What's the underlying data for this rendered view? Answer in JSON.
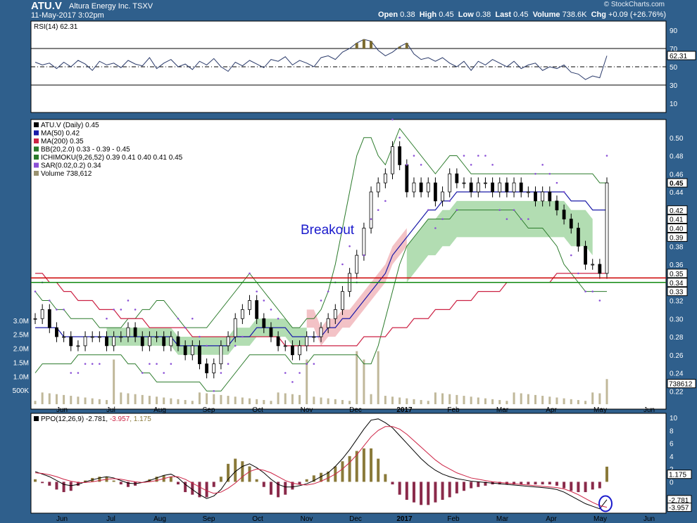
{
  "header": {
    "symbol": "ATU.V",
    "company": "Altura Energy Inc.",
    "exchange": "TSXV",
    "datetime": "11-May-2017 3:02pm",
    "brand": "© StockCharts.com",
    "quote": {
      "open_label": "Open",
      "open": "0.38",
      "high_label": "High",
      "high": "0.45",
      "low_label": "Low",
      "low": "0.38",
      "last_label": "Last",
      "last": "0.45",
      "volume_label": "Volume",
      "volume": "738.6K",
      "chg_label": "Chg",
      "chg": "+0.09 (+26.76%)"
    }
  },
  "colors": {
    "frame": "#2f5f8c",
    "panel": "#ffffff",
    "price": "#000000",
    "ma50": "#1a1aa8",
    "ma200": "#cc2244",
    "bb": "#2a7a2a",
    "kumo_bull": "#9fd49f",
    "kumo_bear": "#f0b3b8",
    "sar": "#8a4fd6",
    "volume": "#c0b89a",
    "resistance": "#cc0000",
    "support": "#118811",
    "annotation": "#1a1acc"
  },
  "chart_data": [
    {
      "type": "line",
      "panel": "rsi",
      "label": "RSI(14) 62.31",
      "yticks": [
        10,
        30,
        50,
        70,
        90
      ],
      "ylim": [
        0,
        100
      ],
      "thresholds": [
        30,
        70
      ],
      "last": 62.31,
      "last_label": "62.31",
      "series": [
        {
          "name": "RSI(14)",
          "values": [
            55,
            52,
            54,
            48,
            55,
            50,
            57,
            53,
            46,
            56,
            52,
            54,
            49,
            57,
            53,
            51,
            60,
            48,
            54,
            58,
            50,
            53,
            47,
            56,
            52,
            59,
            50,
            45,
            55,
            51,
            57,
            53,
            49,
            58,
            56,
            61,
            52,
            57,
            54,
            50,
            60,
            62,
            58,
            66,
            70,
            76,
            80,
            78,
            68,
            62,
            66,
            72,
            76,
            64,
            58,
            60,
            56,
            60,
            54,
            50,
            56,
            46,
            56,
            52,
            58,
            54,
            50,
            56,
            48,
            52,
            54,
            46,
            50,
            48,
            52,
            44,
            42,
            36,
            40,
            38,
            62
          ]
        }
      ]
    },
    {
      "type": "line",
      "panel": "price",
      "title": "ATU.V (Daily) 0.45",
      "ylim": [
        0.2,
        0.52
      ],
      "yticks": [
        0.22,
        0.24,
        0.26,
        0.28,
        0.3,
        0.32,
        0.34,
        0.36,
        0.38,
        0.4,
        0.42,
        0.44,
        0.46,
        0.48,
        0.5
      ],
      "ytick_labels": [
        "0.22",
        "0.24",
        "0.26",
        "0.28",
        "0.30",
        "0.32",
        "0.34",
        "0.36",
        "0.38",
        "0.40",
        "0.42",
        "0.44",
        "0.46",
        "0.48",
        "0.50"
      ],
      "volume_ticks": [
        {
          "label": "3.0M",
          "value": 3000000
        },
        {
          "label": "2.5M",
          "value": 2500000
        },
        {
          "label": "2.0M",
          "value": 2000000
        },
        {
          "label": "1.5M",
          "value": 1500000
        },
        {
          "label": "1.0M",
          "value": 1000000
        },
        {
          "label": "500K",
          "value": 500000
        }
      ],
      "x_labels": [
        "Jun",
        "Jul",
        "Aug",
        "Sep",
        "Oct",
        "Nov",
        "Dec",
        "2017",
        "Feb",
        "Mar",
        "Apr",
        "May",
        "Jun"
      ],
      "legend": [
        {
          "text": "ATU.V (Daily) 0.45",
          "color": "#000000"
        },
        {
          "text": "MA(50) 0.42",
          "color": "#1a1aa8"
        },
        {
          "text": "MA(200) 0.35",
          "color": "#cc2244"
        },
        {
          "text": "BB(20,2.0) 0.33 - 0.39 - 0.45",
          "color": "#2a7a2a"
        },
        {
          "text": "ICHIMOKU(9,26,52) 0.39 0.41 0.40 0.41 0.45",
          "color": "#2a7a2a"
        },
        {
          "text": "SAR(0.02,0.2) 0.34",
          "color": "#8a4fd6"
        },
        {
          "text": "Volume 738,612",
          "color": "#9a9270"
        }
      ],
      "value_tags": [
        {
          "label": "0.45",
          "value": 0.45,
          "bold": true
        },
        {
          "label": "0.42",
          "value": 0.42
        },
        {
          "label": "0.41",
          "value": 0.41
        },
        {
          "label": "0.40",
          "value": 0.4
        },
        {
          "label": "0.39",
          "value": 0.39
        },
        {
          "label": "0.35",
          "value": 0.35
        },
        {
          "label": "0.34",
          "value": 0.34
        },
        {
          "label": "0.33",
          "value": 0.33
        }
      ],
      "volume_tag": "738612",
      "resistance": 0.345,
      "support": 0.34,
      "annotation": "Breakout",
      "series": [
        {
          "name": "ATU.V",
          "values": [
            0.3,
            0.31,
            0.29,
            0.28,
            0.28,
            0.27,
            0.27,
            0.28,
            0.28,
            0.28,
            0.27,
            0.28,
            0.28,
            0.29,
            0.28,
            0.27,
            0.28,
            0.28,
            0.27,
            0.28,
            0.27,
            0.26,
            0.27,
            0.25,
            0.24,
            0.25,
            0.27,
            0.28,
            0.3,
            0.31,
            0.32,
            0.3,
            0.29,
            0.28,
            0.27,
            0.27,
            0.26,
            0.27,
            0.28,
            0.28,
            0.29,
            0.3,
            0.31,
            0.33,
            0.35,
            0.37,
            0.4,
            0.44,
            0.45,
            0.46,
            0.49,
            0.47,
            0.44,
            0.45,
            0.44,
            0.45,
            0.43,
            0.44,
            0.46,
            0.45,
            0.45,
            0.44,
            0.45,
            0.45,
            0.44,
            0.45,
            0.44,
            0.45,
            0.44,
            0.44,
            0.43,
            0.44,
            0.43,
            0.42,
            0.41,
            0.4,
            0.38,
            0.36,
            0.36,
            0.35,
            0.45
          ]
        },
        {
          "name": "MA(50)",
          "values": [
            0.29,
            0.29,
            0.29,
            0.29,
            0.28,
            0.28,
            0.28,
            0.28,
            0.28,
            0.28,
            0.28,
            0.28,
            0.28,
            0.28,
            0.28,
            0.28,
            0.28,
            0.28,
            0.28,
            0.28,
            0.27,
            0.27,
            0.27,
            0.27,
            0.27,
            0.27,
            0.27,
            0.27,
            0.28,
            0.28,
            0.28,
            0.29,
            0.29,
            0.29,
            0.29,
            0.29,
            0.28,
            0.28,
            0.28,
            0.28,
            0.28,
            0.29,
            0.29,
            0.3,
            0.3,
            0.31,
            0.32,
            0.33,
            0.34,
            0.35,
            0.37,
            0.38,
            0.39,
            0.4,
            0.41,
            0.42,
            0.42,
            0.43,
            0.43,
            0.44,
            0.44,
            0.44,
            0.44,
            0.44,
            0.44,
            0.44,
            0.44,
            0.44,
            0.44,
            0.44,
            0.44,
            0.44,
            0.44,
            0.44,
            0.44,
            0.43,
            0.43,
            0.43,
            0.42,
            0.42,
            0.42
          ]
        },
        {
          "name": "MA(200)",
          "values": [
            0.35,
            0.35,
            0.34,
            0.34,
            0.33,
            0.33,
            0.32,
            0.32,
            0.32,
            0.31,
            0.31,
            0.31,
            0.3,
            0.3,
            0.3,
            0.3,
            0.29,
            0.29,
            0.29,
            0.29,
            0.29,
            0.29,
            0.28,
            0.28,
            0.28,
            0.28,
            0.28,
            0.28,
            0.28,
            0.28,
            0.28,
            0.28,
            0.28,
            0.28,
            0.28,
            0.27,
            0.27,
            0.27,
            0.27,
            0.27,
            0.27,
            0.27,
            0.27,
            0.27,
            0.27,
            0.27,
            0.28,
            0.28,
            0.28,
            0.28,
            0.29,
            0.29,
            0.29,
            0.3,
            0.3,
            0.3,
            0.31,
            0.31,
            0.31,
            0.32,
            0.32,
            0.32,
            0.33,
            0.33,
            0.33,
            0.33,
            0.34,
            0.34,
            0.34,
            0.34,
            0.34,
            0.34,
            0.34,
            0.35,
            0.35,
            0.35,
            0.35,
            0.35,
            0.35,
            0.35,
            0.35
          ]
        },
        {
          "name": "BB upper",
          "values": [
            0.33,
            0.32,
            0.32,
            0.31,
            0.31,
            0.3,
            0.3,
            0.3,
            0.3,
            0.29,
            0.29,
            0.29,
            0.29,
            0.3,
            0.3,
            0.31,
            0.31,
            0.32,
            0.32,
            0.31,
            0.3,
            0.29,
            0.29,
            0.29,
            0.29,
            0.3,
            0.31,
            0.32,
            0.33,
            0.34,
            0.35,
            0.34,
            0.33,
            0.32,
            0.31,
            0.3,
            0.29,
            0.29,
            0.3,
            0.3,
            0.31,
            0.33,
            0.36,
            0.4,
            0.44,
            0.48,
            0.5,
            0.5,
            0.48,
            0.47,
            0.49,
            0.51,
            0.5,
            0.49,
            0.48,
            0.47,
            0.46,
            0.47,
            0.48,
            0.48,
            0.47,
            0.46,
            0.46,
            0.46,
            0.46,
            0.46,
            0.46,
            0.46,
            0.46,
            0.46,
            0.46,
            0.46,
            0.46,
            0.46,
            0.46,
            0.46,
            0.46,
            0.46,
            0.46,
            0.45,
            0.45
          ]
        },
        {
          "name": "BB lower",
          "values": [
            0.24,
            0.25,
            0.25,
            0.25,
            0.25,
            0.25,
            0.26,
            0.26,
            0.26,
            0.26,
            0.26,
            0.26,
            0.26,
            0.25,
            0.25,
            0.24,
            0.24,
            0.23,
            0.23,
            0.23,
            0.23,
            0.23,
            0.23,
            0.23,
            0.22,
            0.22,
            0.22,
            0.23,
            0.24,
            0.25,
            0.26,
            0.26,
            0.26,
            0.26,
            0.26,
            0.26,
            0.25,
            0.25,
            0.25,
            0.26,
            0.26,
            0.26,
            0.26,
            0.26,
            0.26,
            0.26,
            0.25,
            0.25,
            0.27,
            0.3,
            0.33,
            0.36,
            0.38,
            0.39,
            0.4,
            0.41,
            0.41,
            0.41,
            0.41,
            0.42,
            0.42,
            0.42,
            0.42,
            0.42,
            0.42,
            0.42,
            0.42,
            0.42,
            0.41,
            0.4,
            0.4,
            0.4,
            0.39,
            0.38,
            0.36,
            0.35,
            0.34,
            0.33,
            0.33,
            0.33,
            0.33
          ]
        }
      ]
    },
    {
      "type": "line",
      "panel": "ppo",
      "label": "PPO(12,26,9) -2.781, -3.957, 1.175",
      "label_parts": [
        "PPO(12,26,9) -2.781, ",
        "-3.957",
        ", 1.175"
      ],
      "ylim": [
        -4,
        10
      ],
      "yticks": [
        0,
        2,
        4,
        6,
        8,
        10
      ],
      "value_tags": [
        {
          "label": "1.175",
          "value": 1.175
        },
        {
          "label": "-2.781",
          "value": -2.781
        },
        {
          "label": "-3.957",
          "value": -3.957
        }
      ],
      "series": [
        {
          "name": "PPO",
          "values": [
            1.6,
            1.2,
            0.8,
            0.2,
            -0.4,
            -0.6,
            -0.4,
            0.0,
            0.3,
            0.6,
            0.8,
            0.6,
            0.2,
            -0.2,
            -0.3,
            -0.1,
            0.2,
            0.6,
            1.0,
            1.2,
            0.6,
            -0.4,
            -1.2,
            -2.0,
            -2.6,
            -2.2,
            -1.2,
            0.4,
            1.6,
            2.4,
            2.8,
            2.2,
            1.4,
            0.4,
            -0.4,
            -0.8,
            -0.8,
            -0.6,
            -0.3,
            0.2,
            0.8,
            1.4,
            2.4,
            3.6,
            5.0,
            6.6,
            8.2,
            9.6,
            9.8,
            9.2,
            8.4,
            7.2,
            6.0,
            4.8,
            3.6,
            2.6,
            1.8,
            1.2,
            0.8,
            0.5,
            0.3,
            0.1,
            0.0,
            -0.1,
            -0.2,
            -0.3,
            -0.4,
            -0.5,
            -0.6,
            -0.7,
            -0.8,
            -0.9,
            -1.0,
            -1.2,
            -1.6,
            -2.2,
            -2.8,
            -3.4,
            -3.8,
            -4.2,
            -2.78
          ]
        },
        {
          "name": "Signal",
          "values": [
            1.4,
            1.3,
            1.1,
            0.8,
            0.4,
            0.1,
            -0.1,
            -0.1,
            0.0,
            0.2,
            0.4,
            0.5,
            0.4,
            0.2,
            0.0,
            -0.1,
            0.0,
            0.2,
            0.5,
            0.8,
            0.8,
            0.4,
            -0.2,
            -0.8,
            -1.4,
            -1.8,
            -1.6,
            -1.0,
            -0.2,
            0.8,
            1.6,
            2.0,
            1.8,
            1.4,
            0.8,
            0.2,
            -0.2,
            -0.4,
            -0.5,
            -0.3,
            0.1,
            0.6,
            1.2,
            2.0,
            3.0,
            4.2,
            5.6,
            7.0,
            8.0,
            8.6,
            8.6,
            8.2,
            7.4,
            6.4,
            5.4,
            4.4,
            3.4,
            2.6,
            2.0,
            1.4,
            1.0,
            0.6,
            0.4,
            0.2,
            0.0,
            -0.1,
            -0.2,
            -0.3,
            -0.4,
            -0.5,
            -0.6,
            -0.7,
            -0.8,
            -0.9,
            -1.1,
            -1.5,
            -2.0,
            -2.6,
            -3.2,
            -3.7,
            -3.96
          ]
        }
      ]
    }
  ]
}
